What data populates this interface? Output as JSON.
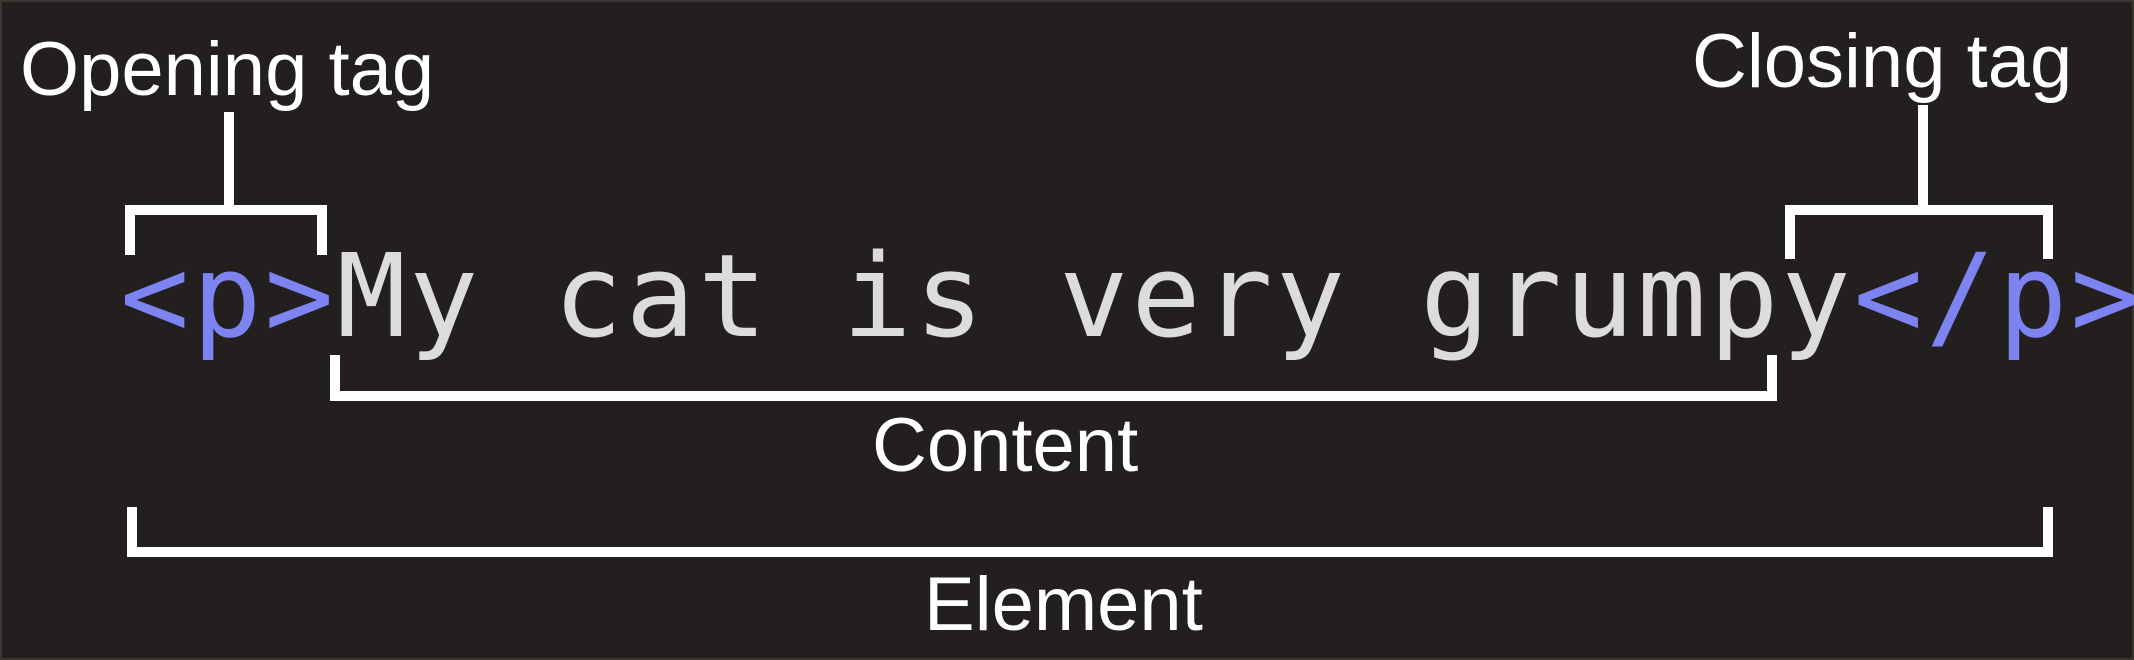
{
  "labels": {
    "opening_tag": "Opening tag",
    "closing_tag": "Closing tag",
    "content": "Content",
    "element": "Element"
  },
  "code": {
    "open_tag": "<p>",
    "content": "My cat is very grumpy",
    "close_tag": "</p>"
  },
  "colors": {
    "background": "#221f1e",
    "tag": "#7d84f2",
    "content_text": "#dcdcdc",
    "annotation": "#ffffff"
  }
}
